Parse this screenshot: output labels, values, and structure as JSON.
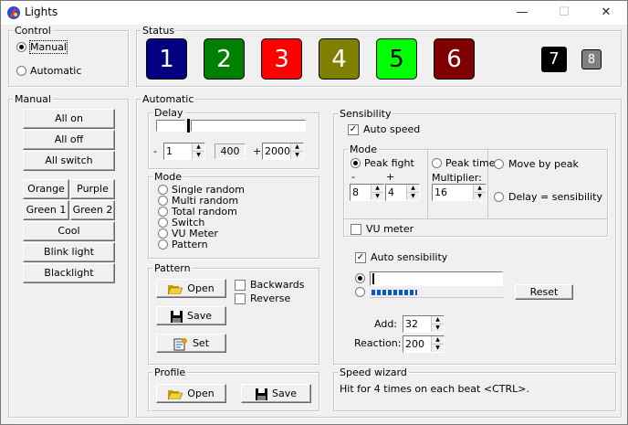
{
  "window": {
    "title": "Lights"
  },
  "control": {
    "title": "Control",
    "options": [
      {
        "label": "Manual",
        "selected": true
      },
      {
        "label": "Automatic",
        "selected": false
      }
    ]
  },
  "status": {
    "title": "Status",
    "tiles": [
      {
        "label": "1",
        "color": "#000080"
      },
      {
        "label": "2",
        "color": "#008000"
      },
      {
        "label": "3",
        "color": "#ff0000"
      },
      {
        "label": "4",
        "color": "#808000"
      },
      {
        "label": "5",
        "color": "#00ff00"
      },
      {
        "label": "6",
        "color": "#800000"
      }
    ],
    "badge7": "7",
    "badge8": "8"
  },
  "manual": {
    "title": "Manual",
    "all_on": "All on",
    "all_off": "All off",
    "all_switch": "All switch",
    "orange": "Orange",
    "purple": "Purple",
    "green1": "Green 1",
    "green2": "Green 2",
    "cool": "Cool",
    "blink": "Blink light",
    "blacklight": "Blacklight"
  },
  "automatic": {
    "title": "Automatic"
  },
  "delay": {
    "title": "Delay",
    "min_sign": "-",
    "min_value": "1",
    "current": "400",
    "max_sign": "+",
    "max_value": "2000"
  },
  "mode": {
    "title": "Mode",
    "options": [
      {
        "label": "Single random",
        "selected": false
      },
      {
        "label": "Multi random",
        "selected": false
      },
      {
        "label": "Total random",
        "selected": false
      },
      {
        "label": "Switch",
        "selected": false
      },
      {
        "label": "VU Meter",
        "selected": false
      },
      {
        "label": "Pattern",
        "selected": false
      }
    ]
  },
  "pattern": {
    "title": "Pattern",
    "open": "Open",
    "save": "Save",
    "set": "Set",
    "backwards": "Backwards",
    "reverse": "Reverse"
  },
  "profile": {
    "title": "Profile",
    "open": "Open",
    "save": "Save"
  },
  "sensibility": {
    "title": "Sensibility",
    "auto_speed": "Auto speed",
    "mode_title": "Mode",
    "peak_fight": "Peak fight",
    "minus": "-",
    "plus": "+",
    "pf_min": "8",
    "pf_max": "4",
    "peak_time": "Peak time",
    "multiplier_label": "Multiplier:",
    "multiplier": "16",
    "move_by_peak": "Move by peak",
    "delay_eq": "Delay = sensibility",
    "vu_meter": "VU meter",
    "auto_sensibility": "Auto sensibility",
    "reset": "Reset",
    "add_label": "Add:",
    "add_value": "32",
    "reaction_label": "Reaction:",
    "reaction_value": "200",
    "level_fraction": 0.36
  },
  "wizard": {
    "title": "Speed wizard",
    "text": "Hit for 4 times on each beat <CTRL>."
  }
}
